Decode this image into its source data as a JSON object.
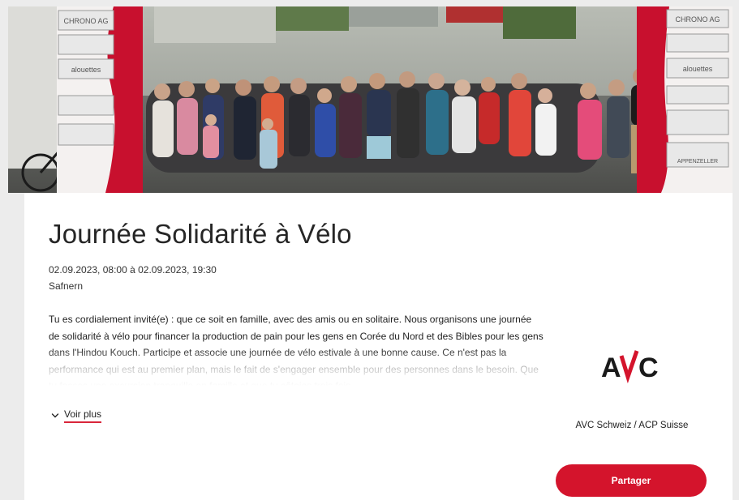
{
  "event": {
    "title": "Journée Solidarité à Vélo",
    "datetime": "02.09.2023, 08:00 à 02.09.2023, 19:30",
    "location": "Safnern",
    "description": "Tu es cordialement invité(e) : que ce soit en famille, avec des amis ou en solitaire. Nous organisons une journée de solidarité à vélo pour financer la production de pain pour les gens en Corée du Nord et des Bibles pour les gens dans l'Hindou Kouch. Participe et associe une journée de vélo estivale à une bonne cause. Ce n'est pas la performance qui est au premier plan, mais le fait de s'engager ensemble pour des personnes dans le besoin. Que tu fasses une excursion tranquille en famille et que tu côtoies trois fois",
    "more_label": "Voir plus"
  },
  "organizer": {
    "logo_text": "AVC",
    "name": "AVC Schweiz / ACP Suisse"
  },
  "share_label": "Partager",
  "banner_left": [
    "CHRONO AG",
    "alouettes"
  ],
  "banner_right": [
    "CHRONO AG",
    "alouettes",
    "APPENZELLER"
  ],
  "colors": {
    "accent": "#d4142c",
    "text": "#222222",
    "banner_red": "#c8102e"
  },
  "icons": {
    "more": "chevron-down-icon"
  }
}
